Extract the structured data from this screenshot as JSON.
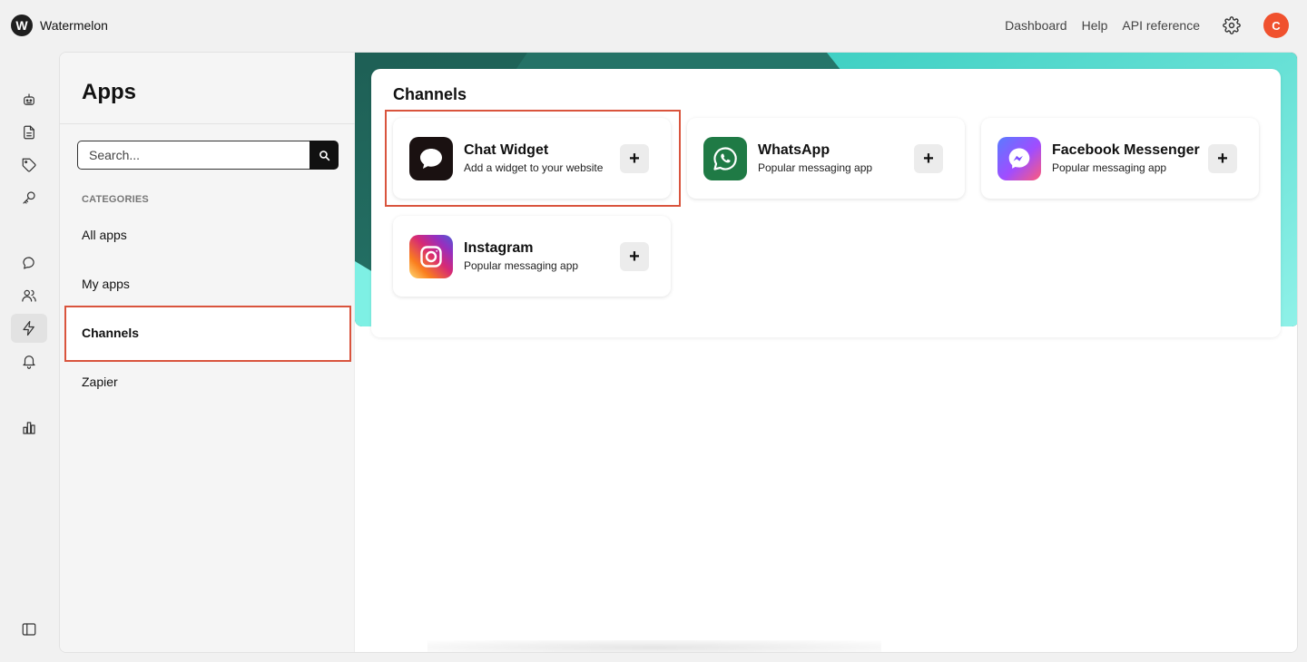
{
  "brand": {
    "logo_letter": "W",
    "name": "Watermelon"
  },
  "topnav": {
    "links": [
      "Dashboard",
      "Help",
      "API reference"
    ],
    "avatar_initial": "C"
  },
  "rail": {
    "items": [
      "bot-icon",
      "document-icon",
      "tag-icon",
      "key-icon",
      "chat-icon",
      "users-icon",
      "lightning-icon",
      "bell-icon",
      "chart-icon"
    ],
    "active": "lightning-icon",
    "bottom": "sidebar-toggle-icon"
  },
  "apps_sidebar": {
    "title": "Apps",
    "search_placeholder": "Search...",
    "categories_label": "CATEGORIES",
    "categories": [
      "All apps",
      "My apps",
      "Channels",
      "Zapier"
    ],
    "active_category": "Channels"
  },
  "main": {
    "section_title": "Channels",
    "apps": [
      {
        "name": "Chat Widget",
        "description": "Add a widget to your website",
        "icon": "chat-bubble-icon",
        "color": "#1a1111",
        "add_label": "+"
      },
      {
        "name": "WhatsApp",
        "description": "Popular messaging app",
        "icon": "whatsapp-icon",
        "color": "#1f7a45",
        "add_label": "+"
      },
      {
        "name": "Facebook Messenger",
        "description": "Popular messaging app",
        "icon": "messenger-icon",
        "color": "#7b4dff",
        "add_label": "+"
      },
      {
        "name": "Instagram",
        "description": "Popular messaging app",
        "icon": "instagram-icon",
        "color": "#e1306c",
        "add_label": "+"
      }
    ]
  },
  "colors": {
    "accent": "#f0512e",
    "highlight": "#d9543d",
    "hero_dark": "#1e6b61",
    "hero_light": "#5ee0d6"
  }
}
